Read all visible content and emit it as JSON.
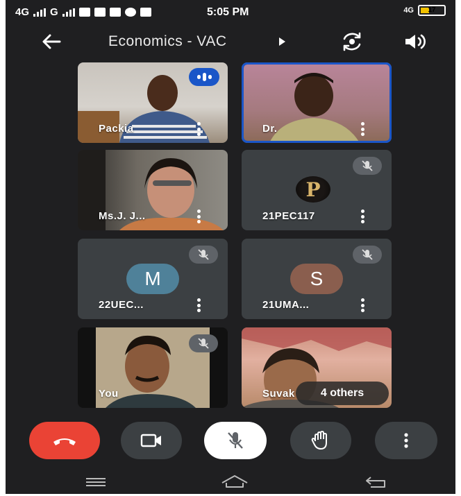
{
  "status_bar": {
    "network_left": "4G",
    "network_mid": "G",
    "time": "5:05 PM",
    "network_right": "4G",
    "battery": "17"
  },
  "header": {
    "title": "Economics - VAC"
  },
  "tiles": [
    {
      "name": "Packia",
      "kind": "video",
      "speaking": true
    },
    {
      "name": "Dr.",
      "kind": "video",
      "active_speaker": true
    },
    {
      "name": "Ms.J. J...",
      "kind": "video"
    },
    {
      "name": "21PEC117",
      "kind": "avatar",
      "avatar_letter": "P",
      "muted": true
    },
    {
      "name": "22UEC...",
      "kind": "avatar",
      "avatar_letter": "M",
      "avatar_color": "#4f8199",
      "muted": true
    },
    {
      "name": "21UMA...",
      "kind": "avatar",
      "avatar_letter": "S",
      "avatar_color": "#8a5e4e",
      "muted": true
    },
    {
      "name": "You",
      "kind": "video",
      "muted": true
    },
    {
      "name": "Suvak",
      "kind": "video"
    }
  ],
  "others_label": "4 others",
  "colors": {
    "background": "#1f1f21",
    "end_call": "#ea4335",
    "control": "#3c4043",
    "highlight_border": "#1a56c8"
  },
  "controls": [
    "end-call",
    "camera",
    "microphone-muted",
    "raise-hand",
    "more-options"
  ]
}
